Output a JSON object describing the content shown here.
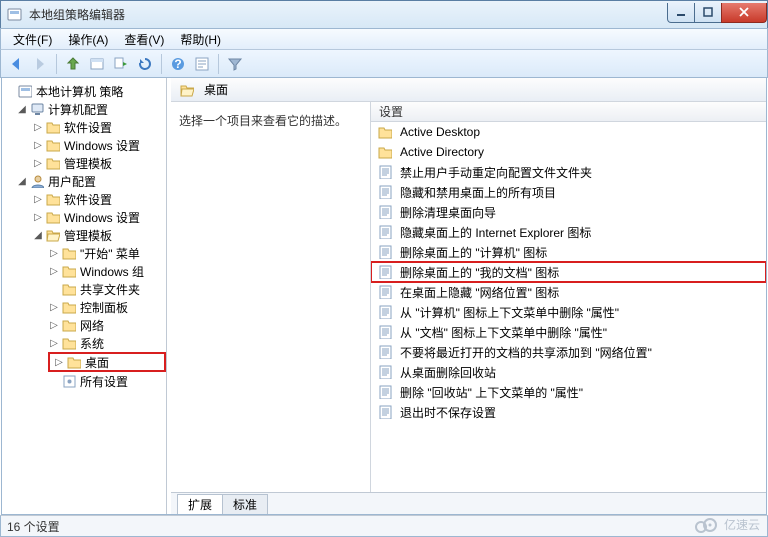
{
  "window": {
    "title": "本地组策略编辑器"
  },
  "menu": {
    "file": "文件(F)",
    "action": "操作(A)",
    "view": "查看(V)",
    "help": "帮助(H)"
  },
  "tree": {
    "root": "本地计算机 策略",
    "computer": "计算机配置",
    "comp_soft": "软件设置",
    "comp_win": "Windows 设置",
    "comp_admin": "管理模板",
    "user": "用户配置",
    "user_soft": "软件设置",
    "user_win": "Windows 设置",
    "user_admin": "管理模板",
    "start_menu": "\"开始\" 菜单",
    "win_group": "Windows 组",
    "shared": "共享文件夹",
    "ctrlpanel": "控制面板",
    "network": "网络",
    "system": "系统",
    "desktop": "桌面",
    "all_settings": "所有设置"
  },
  "right": {
    "header": "桌面",
    "desc": "选择一个项目来查看它的描述。",
    "col_setting": "设置",
    "items": [
      {
        "t": "folder",
        "label": "Active Desktop"
      },
      {
        "t": "folder",
        "label": "Active Directory"
      },
      {
        "t": "policy",
        "label": "禁止用户手动重定向配置文件文件夹"
      },
      {
        "t": "policy",
        "label": "隐藏和禁用桌面上的所有项目"
      },
      {
        "t": "policy",
        "label": "删除清理桌面向导"
      },
      {
        "t": "policy",
        "label": "隐藏桌面上的 Internet Explorer 图标"
      },
      {
        "t": "policy",
        "label": "删除桌面上的 \"计算机\" 图标"
      },
      {
        "t": "policy",
        "label": "删除桌面上的 \"我的文档\" 图标",
        "hl": true
      },
      {
        "t": "policy",
        "label": "在桌面上隐藏 \"网络位置\" 图标"
      },
      {
        "t": "policy",
        "label": "从 \"计算机\" 图标上下文菜单中删除 \"属性\""
      },
      {
        "t": "policy",
        "label": "从 \"文档\" 图标上下文菜单中删除 \"属性\""
      },
      {
        "t": "policy",
        "label": "不要将最近打开的文档的共享添加到 \"网络位置\""
      },
      {
        "t": "policy",
        "label": "从桌面删除回收站"
      },
      {
        "t": "policy",
        "label": "删除 \"回收站\" 上下文菜单的 \"属性\""
      },
      {
        "t": "policy",
        "label": "退出时不保存设置"
      }
    ],
    "tab_ext": "扩展",
    "tab_std": "标准"
  },
  "status": "16 个设置",
  "watermark": "亿速云"
}
